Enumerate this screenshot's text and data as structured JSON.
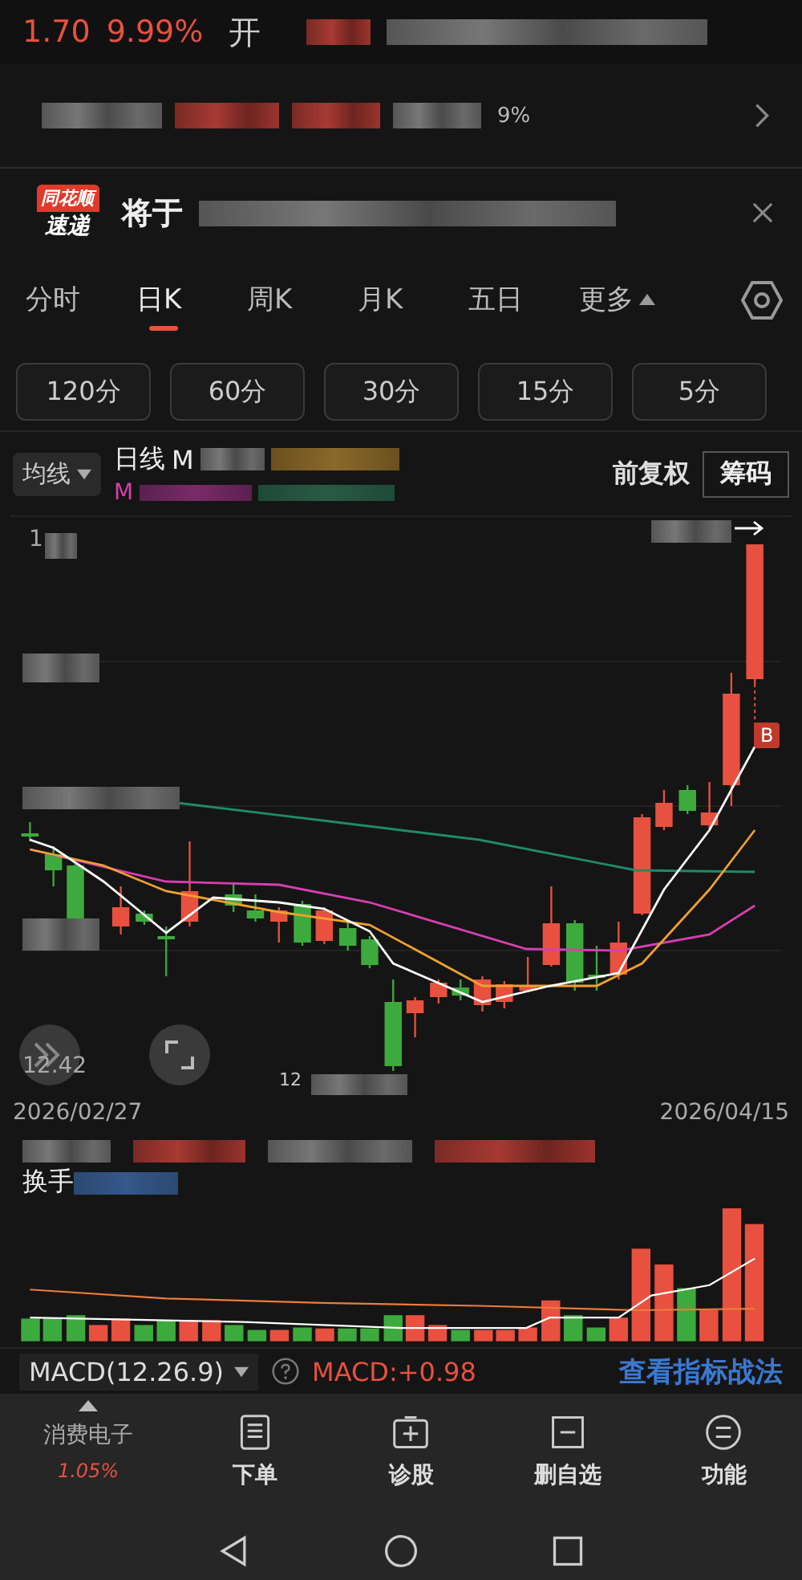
{
  "quote": {
    "price": "1.70",
    "change_pct": "9.99%",
    "open_label": "开"
  },
  "summary": {
    "fragment": "9%"
  },
  "news": {
    "badge_top": "同花顺",
    "badge_bottom": "速递",
    "headline": "将于"
  },
  "period_tabs": [
    {
      "label": "分时",
      "selected": false,
      "dropdown": false
    },
    {
      "label": "日K",
      "selected": true,
      "dropdown": false
    },
    {
      "label": "周K",
      "selected": false,
      "dropdown": false
    },
    {
      "label": "月K",
      "selected": false,
      "dropdown": false
    },
    {
      "label": "五日",
      "selected": false,
      "dropdown": false
    },
    {
      "label": "更多",
      "selected": false,
      "dropdown": true
    }
  ],
  "intervals": [
    "120分",
    "60分",
    "30分",
    "15分",
    "5分"
  ],
  "indicator_bar": {
    "ma_dropdown": "均线",
    "line_label": "日线",
    "ma_prefix": "M",
    "ma_prefix_2": "M",
    "adjust": "前复权",
    "chips": "筹码"
  },
  "chart": {
    "top_label": "1",
    "low_label": "12.42",
    "bottom_label": "12",
    "marker": "B",
    "start_date": "2026/02/27",
    "end_date": "2026/04/15"
  },
  "volume": {
    "label": "换手"
  },
  "macd": {
    "selector": "MACD(12.26.9)",
    "value": "MACD:+0.98",
    "link": "查看指标战法"
  },
  "sector": {
    "name": "消费电子",
    "change": "1.05%"
  },
  "actions": [
    {
      "label": "下单",
      "kind": "order"
    },
    {
      "label": "诊股",
      "kind": "diagnose"
    },
    {
      "label": "删自选",
      "kind": "remove"
    },
    {
      "label": "功能",
      "kind": "functions"
    }
  ]
}
